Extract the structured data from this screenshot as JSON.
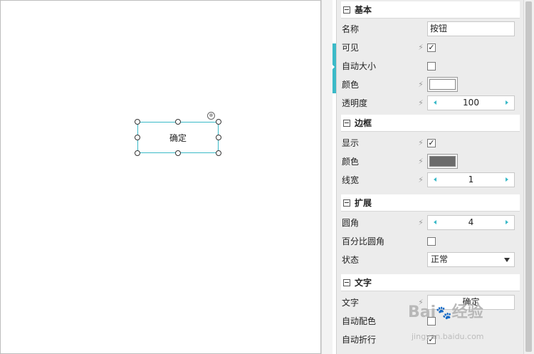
{
  "canvas": {
    "button_text": "确定"
  },
  "sections": {
    "basic": {
      "title": "基本",
      "name_label": "名称",
      "name_value": "按钮",
      "visible_label": "可见",
      "autosize_label": "自动大小",
      "color_label": "颜色",
      "color_value": "#ffffff",
      "opacity_label": "透明度",
      "opacity_value": "100"
    },
    "border": {
      "title": "边框",
      "show_label": "显示",
      "color_label": "颜色",
      "color_value": "#6b6b6b",
      "width_label": "线宽",
      "width_value": "1"
    },
    "extend": {
      "title": "扩展",
      "radius_label": "圆角",
      "radius_value": "4",
      "percent_radius_label": "百分比圆角",
      "state_label": "状态",
      "state_value": "正常"
    },
    "text": {
      "title": "文字",
      "text_label": "文字",
      "text_value": "确定",
      "autocolor_label": "自动配色",
      "wrap_label": "自动折行"
    }
  },
  "icons": {
    "bolt": "⚡",
    "check": "✓"
  },
  "watermark": {
    "brand": "Bai",
    "brand2": "经验",
    "url": "jingyan.baidu.com"
  }
}
